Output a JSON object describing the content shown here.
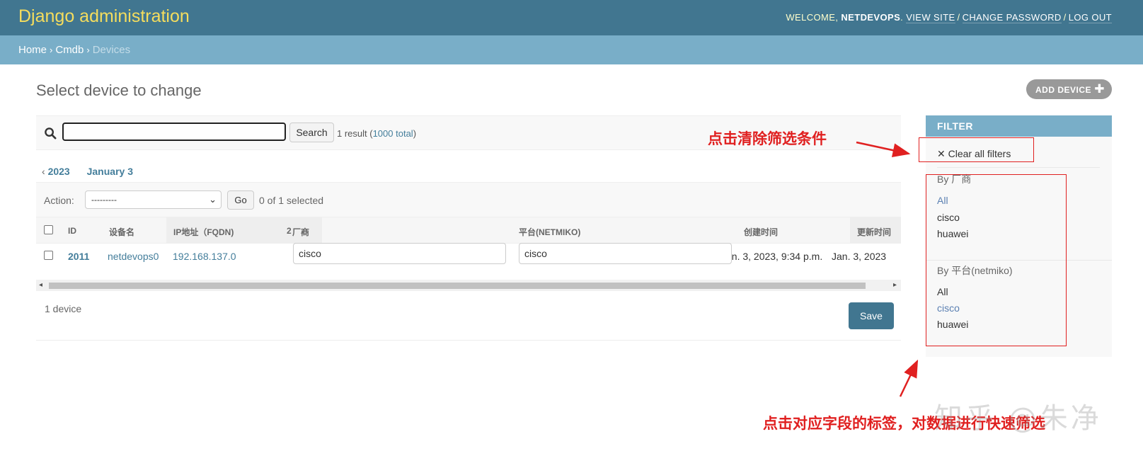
{
  "header": {
    "brand": "Django administration",
    "welcome": "WELCOME,",
    "username": "NETDEVOPS",
    "view_site": "VIEW SITE",
    "change_password": "CHANGE PASSWORD",
    "log_out": "LOG OUT"
  },
  "breadcrumbs": {
    "home": "Home",
    "app": "Cmdb",
    "current": "Devices"
  },
  "page": {
    "title": "Select device to change",
    "add_button": "ADD DEVICE"
  },
  "search": {
    "value": "",
    "button": "Search",
    "result_prefix": "1 result (",
    "total_link": "1000 total",
    "result_suffix": ")"
  },
  "date_hierarchy": {
    "back": "2023",
    "current": "January 3"
  },
  "actions": {
    "label": "Action:",
    "selected_option": "---------",
    "go": "Go",
    "selected_count": "0 of 1 selected"
  },
  "table": {
    "columns": [
      "ID",
      "设备名",
      "IP地址（FQDN)",
      "厂商",
      "平台(NETMIKO)",
      "创建时间",
      "更新时间"
    ],
    "sort_priority": "2",
    "rows": [
      {
        "id": "2011",
        "name": "netdevops0",
        "ip": "192.168.137.0",
        "vendor": "cisco",
        "platform": "cisco",
        "created": "Jan. 3, 2023, 9:34 p.m.",
        "updated": "Jan. 3, 2023"
      }
    ]
  },
  "footer": {
    "count": "1 device",
    "save": "Save"
  },
  "filter": {
    "header": "FILTER",
    "clear": "Clear all filters",
    "groups": [
      {
        "title": "By 厂商",
        "options": [
          "All",
          "cisco",
          "huawei"
        ],
        "selected": "All"
      },
      {
        "title": "By 平台(netmiko)",
        "options": [
          "All",
          "cisco",
          "huawei"
        ],
        "selected": "cisco"
      }
    ]
  },
  "annotations": {
    "clear_note": "点击清除筛选条件",
    "filter_note": "点击对应字段的标签，对数据进行快速筛选",
    "watermark": "知乎 @朱净"
  },
  "colors": {
    "header_bg": "#417690",
    "brand": "#f5dd5d",
    "breadcrumb_bg": "#79aec8",
    "link": "#447e9b",
    "annotation_red": "#e02020"
  }
}
